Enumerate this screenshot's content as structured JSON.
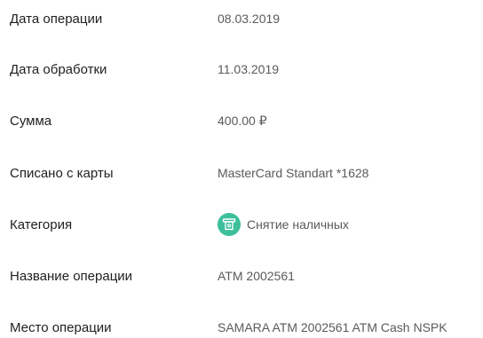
{
  "accent_color": "#3dbf9c",
  "operation_details": {
    "rows": [
      {
        "label": "Дата операции",
        "value": "08.03.2019"
      },
      {
        "label": "Дата обработки",
        "value": "11.03.2019"
      },
      {
        "label": "Сумма",
        "value": "400.00 ₽"
      },
      {
        "label": "Списано с карты",
        "value": "MasterCard Standart *1628"
      },
      {
        "label": "Категория",
        "value": "Снятие наличных",
        "icon": "cash-withdrawal-icon"
      },
      {
        "label": "Название операции",
        "value": "ATM 2002561"
      },
      {
        "label": "Место операции",
        "value": "SAMARA ATM 2002561 ATM Cash NSPK"
      }
    ]
  }
}
